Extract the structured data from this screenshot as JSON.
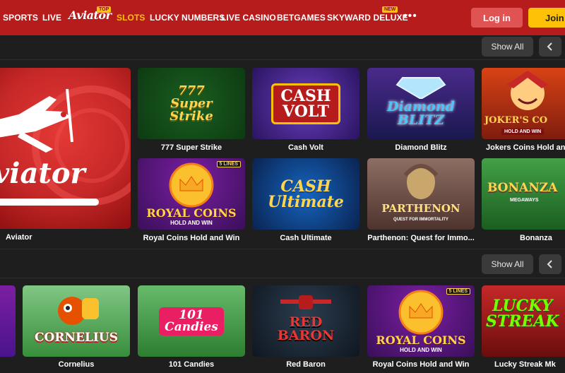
{
  "nav": {
    "items": [
      "SPORTS",
      "LIVE",
      "SLOTS",
      "LUCKY NUMBERS",
      "LIVE CASINO",
      "BETGAMES",
      "SKYWARD DELUXE"
    ],
    "brand": "Aviator",
    "brand_badge": "TOP",
    "skyward_badge": "NEW",
    "more": "•••",
    "login": "Log in",
    "join": "Join"
  },
  "section1": {
    "show_all": "Show All",
    "featured": {
      "title": "Aviator",
      "art_text": "viator"
    },
    "games": [
      {
        "title": "777 Super Strike",
        "art": "777\nSuper\nStrike"
      },
      {
        "title": "Cash Volt",
        "art": "CASH\nVOLT"
      },
      {
        "title": "Diamond Blitz",
        "art": "Diamond\nBLITZ"
      },
      {
        "title": "Jokers Coins Hold and Win",
        "art": "JOKER'S CO",
        "sub": "HOLD AND WIN"
      },
      {
        "title": "Royal Coins Hold and Win",
        "art": "ROYAL COINS",
        "sub": "HOLD AND WIN",
        "tag": "5 LINES"
      },
      {
        "title": "Cash Ultimate",
        "art": "CASH\nUltimate"
      },
      {
        "title": "Parthenon: Quest for Immo...",
        "art": "PARTHENON",
        "sub": "QUEST FOR IMMORTALITY"
      },
      {
        "title": "Bonanza",
        "art": "BONANZA",
        "sub": "MEGAWAYS"
      }
    ]
  },
  "section2": {
    "show_all": "Show All",
    "games": [
      {
        "title": "Cornelius",
        "art": "CORNELIUS"
      },
      {
        "title": "101 Candies",
        "art": "101\nCandies"
      },
      {
        "title": "Red Baron",
        "art": "RED\nBARON"
      },
      {
        "title": "Royal Coins Hold and Win",
        "art": "ROYAL COINS",
        "sub": "HOLD AND WIN",
        "tag": "5 LINES"
      },
      {
        "title": "Lucky Streak Mk",
        "art": "LUCKY\nSTREAK"
      }
    ]
  },
  "colors": {
    "header": "#b71c1c",
    "accent": "#ffc107",
    "login": "#e05353",
    "background": "#1e1e1e"
  }
}
